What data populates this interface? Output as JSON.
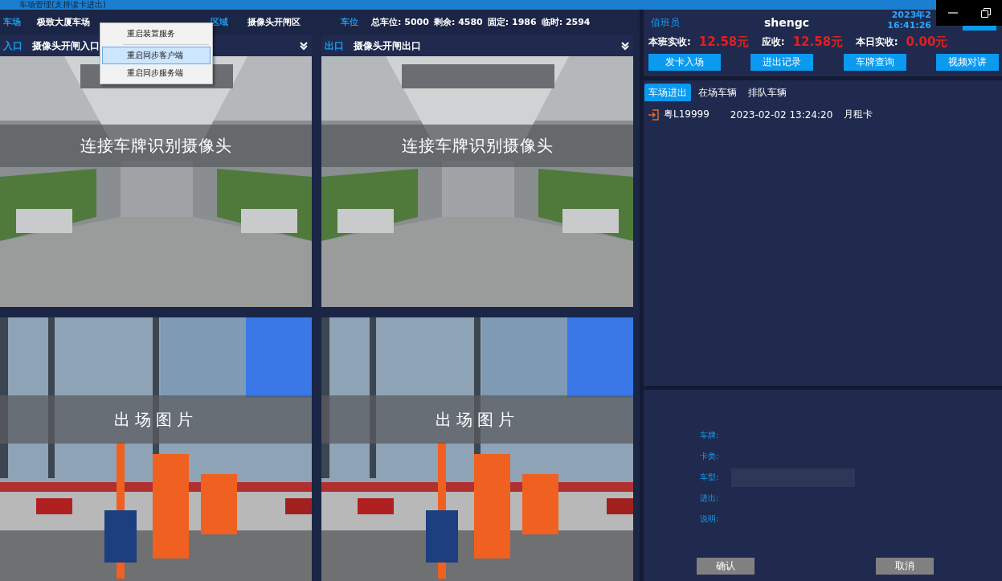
{
  "title_bar": {
    "title": "车场管理(支持读卡进出)"
  },
  "header": {
    "lot_label": "车场",
    "lot_name": "极致大厦车场",
    "area_label": "区域",
    "area_name": "摄像头开闸区",
    "spaces_label": "车位",
    "stats": [
      {
        "label": "总车位:",
        "value": "5000"
      },
      {
        "label": "剩余:",
        "value": "4580"
      },
      {
        "label": "固定:",
        "value": "1986"
      },
      {
        "label": "临时:",
        "value": "2594"
      }
    ]
  },
  "cameras": [
    {
      "direction": "入口",
      "name": "摄像头开闸入口",
      "overlay": "连接车牌识别摄像头",
      "kind": "garage"
    },
    {
      "direction": "出口",
      "name": "摄像头开闸出口",
      "overlay": "连接车牌识别摄像头",
      "kind": "garage"
    }
  ],
  "photos": [
    {
      "caption": "出场图片",
      "kind": "gate"
    },
    {
      "caption": "出场图片",
      "kind": "gate"
    }
  ],
  "context_menu": {
    "items": [
      {
        "label": "重启装置服务",
        "selected": false
      },
      {
        "label": "重启同步客户端",
        "selected": true
      },
      {
        "label": "重启同步服务端",
        "selected": false
      }
    ]
  },
  "operator": {
    "label": "值班员",
    "name": "shengc",
    "date": "2023年2",
    "time": "16:41:26"
  },
  "income": [
    {
      "label": "本班实收:",
      "value": "12.58元"
    },
    {
      "label": "应收:",
      "value": "12.58元"
    },
    {
      "label": "本日实收:",
      "value": "0.00元"
    }
  ],
  "actions": [
    "发卡入场",
    "进出记录",
    "车牌查询",
    "视频对讲"
  ],
  "tabs": [
    {
      "label": "车场进出",
      "selected": true
    },
    {
      "label": "在场车辆",
      "selected": false
    },
    {
      "label": "排队车辆",
      "selected": false
    }
  ],
  "records": [
    {
      "plate": "粤L19999",
      "time": "2023-02-02 13:24:20",
      "card_type": "月租卡"
    }
  ],
  "form": {
    "fields": [
      {
        "label": "车牌:",
        "kind": "text"
      },
      {
        "label": "卡类:",
        "kind": "text"
      },
      {
        "label": "车型:",
        "kind": "input"
      },
      {
        "label": "进出:",
        "kind": "text"
      },
      {
        "label": "说明:",
        "kind": "text"
      }
    ],
    "buttons": [
      "确认",
      "取消"
    ]
  }
}
